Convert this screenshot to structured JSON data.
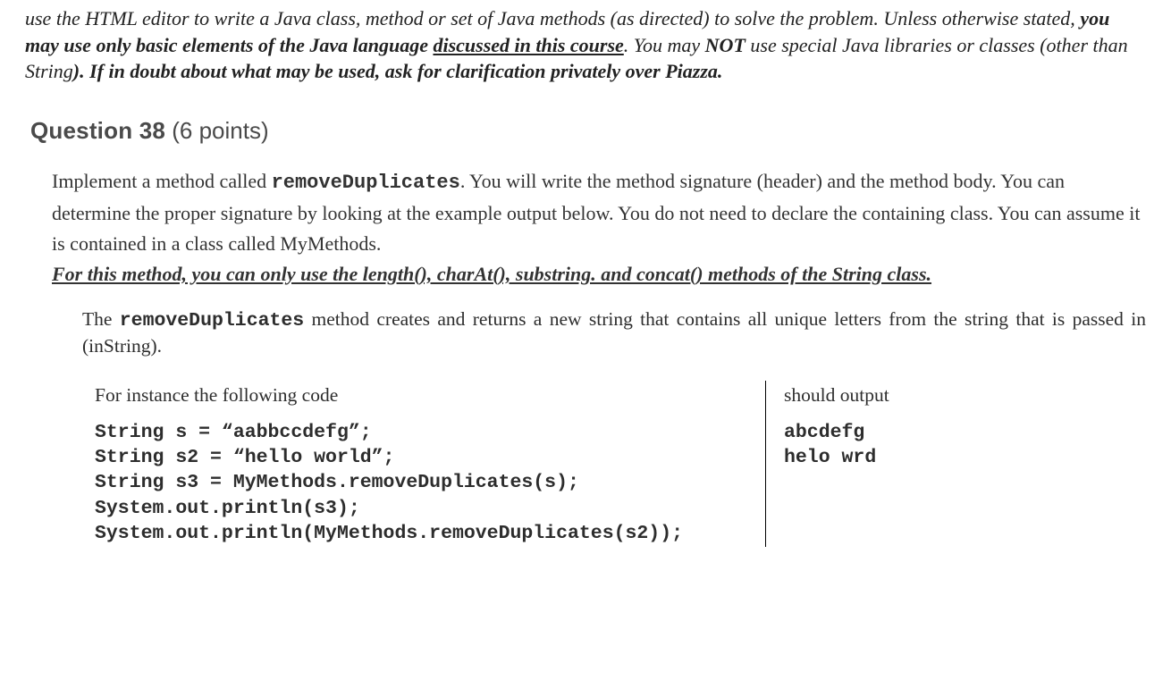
{
  "intro": {
    "part1": "use the HTML editor to write a Java class, method or set of Java methods (as directed) to solve the problem. Unless otherwise stated, ",
    "bold1": "you may use only basic elements of the Java language ",
    "bold1u": "discussed in this course",
    "period1": ". ",
    "part2": "You may ",
    "not": "NOT",
    "part3": " use special Java libraries or classes (other than String",
    "bold2": "). If in doubt about what may be used, ask for clarification privately over Piazza",
    "period2": "."
  },
  "question": {
    "number": "Question 38",
    "points": " (6 points)"
  },
  "body": {
    "p1a": "Implement a method called ",
    "method": "removeDuplicates",
    "p1b": ". You will write the method signature (header) and the method body.  You can determine the proper signature by looking at the example output below.  You do not need to declare the containing class.  You can assume it is contained in a class called MyMethods.",
    "constraint": "For this method, you can only use the length(), charAt(), substring. and concat() methods of the String class."
  },
  "desc": {
    "a": "The ",
    "method": "removeDuplicates",
    "b": " method creates and returns a new string that contains all unique letters from the string that is passed in (inString)."
  },
  "example": {
    "left_intro": "For instance the following code",
    "right_intro": "should output",
    "code": "String s = “aabbccdefg”;\nString s2 = “hello world”;\nString s3 = MyMethods.removeDuplicates(s);\nSystem.out.println(s3);\nSystem.out.println(MyMethods.removeDuplicates(s2));",
    "output": "abcdefg\nhelo wrd"
  }
}
